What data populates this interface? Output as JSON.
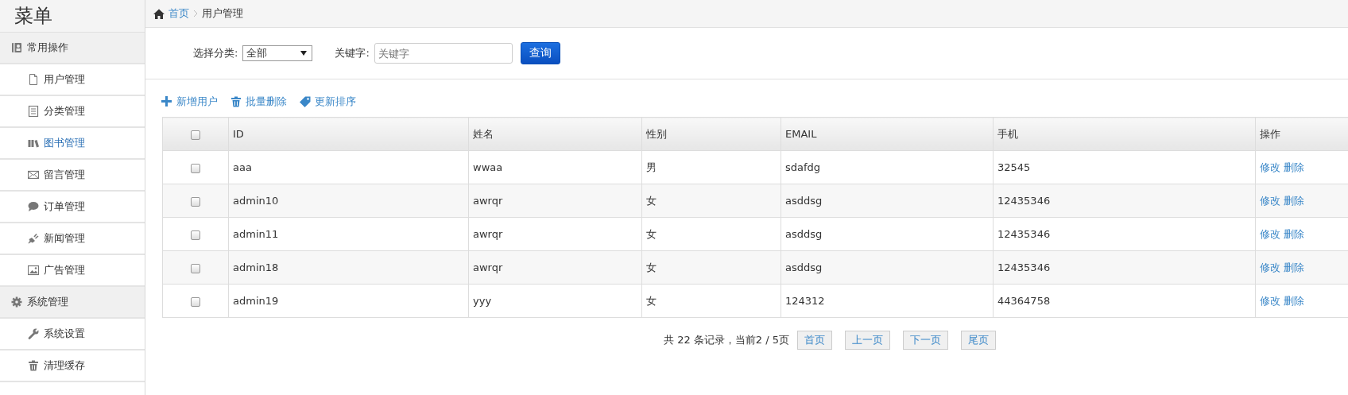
{
  "sidebar": {
    "title": "菜单",
    "groups": [
      {
        "label": "常用操作",
        "items": [
          {
            "label": "用户管理",
            "selected": false
          },
          {
            "label": "分类管理",
            "selected": false
          },
          {
            "label": "图书管理",
            "selected": true
          },
          {
            "label": "留言管理",
            "selected": false
          },
          {
            "label": "订单管理",
            "selected": false
          },
          {
            "label": "新闻管理",
            "selected": false
          },
          {
            "label": "广告管理",
            "selected": false
          }
        ]
      },
      {
        "label": "系统管理",
        "items": [
          {
            "label": "系统设置",
            "selected": false
          },
          {
            "label": "清理缓存",
            "selected": false
          }
        ]
      }
    ]
  },
  "breadcrumb": [
    "首页",
    "用户管理"
  ],
  "filter": {
    "category_label": "选择分类:",
    "category_value": "全部",
    "keyword_label": "关键字:",
    "keyword_placeholder": "关键字",
    "submit": "查询"
  },
  "toolbar": [
    "新增用户",
    "批量删除",
    "更新排序"
  ],
  "table": {
    "select_all_checked": false,
    "columns": [
      "ID",
      "姓名",
      "性别",
      "EMAIL",
      "手机",
      "操作"
    ],
    "rows": [
      {
        "checked": false,
        "cells": [
          "aaa",
          "wwaa",
          "男",
          "sdafdg",
          "32545"
        ],
        "actions": [
          "修改",
          "删除"
        ]
      },
      {
        "checked": false,
        "cells": [
          "admin10",
          "awrqr",
          "女",
          "asddsg",
          "12435346"
        ],
        "actions": [
          "修改",
          "删除"
        ]
      },
      {
        "checked": false,
        "cells": [
          "admin11",
          "awrqr",
          "女",
          "asddsg",
          "12435346"
        ],
        "actions": [
          "修改",
          "删除"
        ]
      },
      {
        "checked": false,
        "cells": [
          "admin18",
          "awrqr",
          "女",
          "asddsg",
          "12435346"
        ],
        "actions": [
          "修改",
          "删除"
        ]
      },
      {
        "checked": false,
        "cells": [
          "admin19",
          "yyy",
          "女",
          "124312",
          "44364758"
        ],
        "actions": [
          "修改",
          "删除"
        ]
      }
    ]
  },
  "pagination": {
    "summary": "共 22 条记录，当前2 / 5页",
    "buttons": [
      "首页",
      "上一页",
      "下一页",
      "尾页"
    ]
  }
}
